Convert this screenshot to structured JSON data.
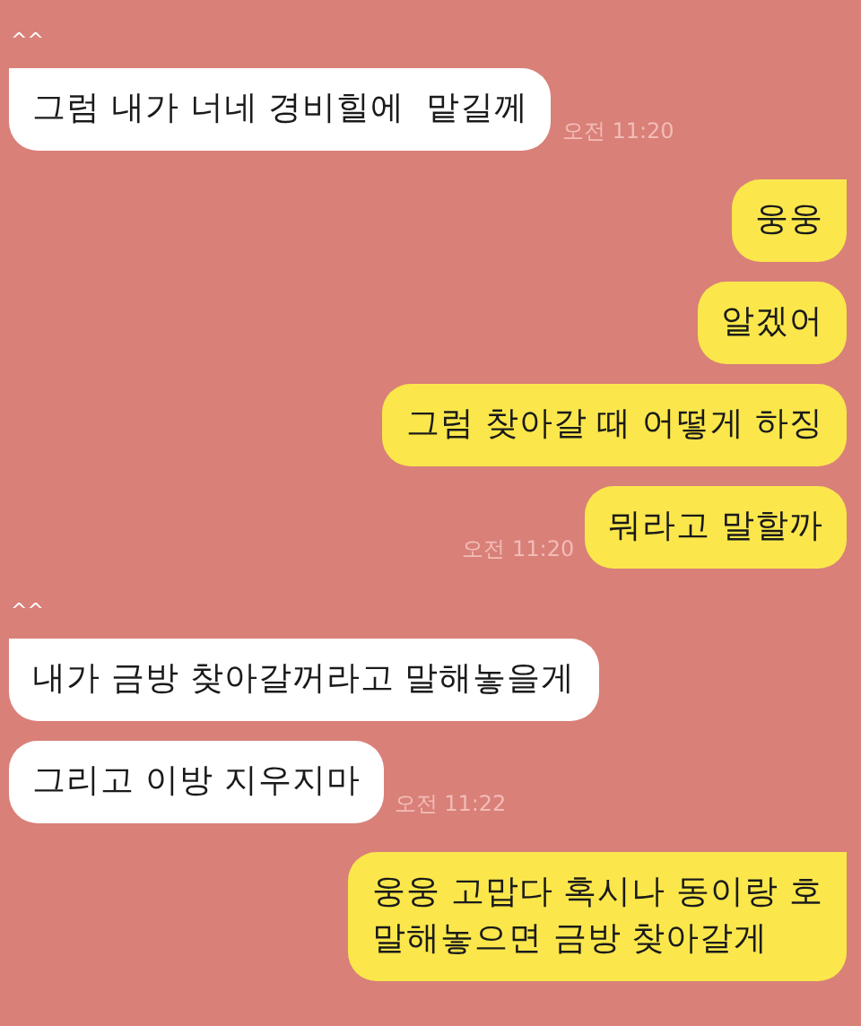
{
  "messages": [
    {
      "kind": "fragment",
      "text": "^^"
    },
    {
      "kind": "received",
      "text": "그럼 내가 너네 경비힐에  맡길께",
      "tail": true,
      "time": "오전 11:20"
    },
    {
      "kind": "sent",
      "text": "웅웅",
      "tail": true
    },
    {
      "kind": "sent",
      "text": "알겠어",
      "tail": false
    },
    {
      "kind": "sent",
      "text": "그럼 찾아갈 때 어떻게 하징",
      "tail": false
    },
    {
      "kind": "sent",
      "text": "뭐라고 말할까",
      "tail": false,
      "time": "오전 11:20"
    },
    {
      "kind": "fragment",
      "text": "^^"
    },
    {
      "kind": "received",
      "text": "내가 금방 찾아갈꺼라고 말해놓을게",
      "tail": true
    },
    {
      "kind": "received",
      "text": "그리고 이방 지우지마",
      "tail": false,
      "time": "오전 11:22"
    },
    {
      "kind": "sent",
      "text": "웅웅 고맙다 혹시나 동이랑 호\n말해놓으면 금방 찾아갈게",
      "tail": true
    }
  ]
}
